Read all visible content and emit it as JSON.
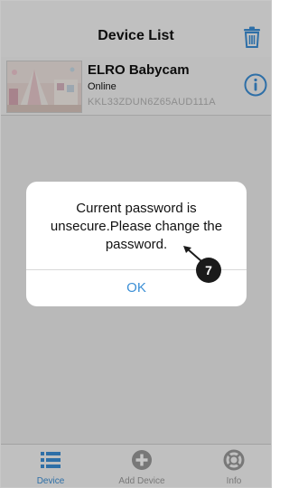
{
  "header": {
    "title": "Device List",
    "delete_icon": "trash-icon"
  },
  "devices": [
    {
      "name": "ELRO Babycam",
      "status": "Online",
      "uid": "KKL33ZDUN6Z65AUD111A",
      "info_icon": "info-icon"
    }
  ],
  "dialog": {
    "message": "Current password is unsecure.Please change the password.",
    "ok_label": "OK"
  },
  "annotation": {
    "badge_number": "7"
  },
  "tabbar": {
    "items": [
      {
        "label": "Device",
        "icon": "list-icon",
        "active": true
      },
      {
        "label": "Add Device",
        "icon": "plus-circle-icon",
        "active": false
      },
      {
        "label": "Info",
        "icon": "lifebuoy-icon",
        "active": false
      }
    ]
  },
  "colors": {
    "accent": "#3b8fd6",
    "inactive": "#9a9a9a",
    "badge": "#1a1a1a"
  }
}
